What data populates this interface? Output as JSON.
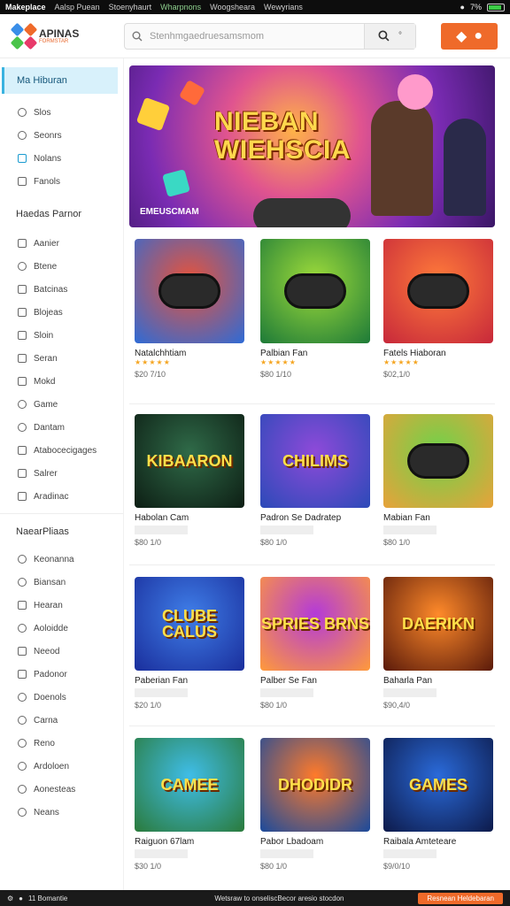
{
  "statusbar": {
    "app": "Makeplace",
    "items": [
      "Aalsp Puean",
      "Stoenyhaurt",
      "Wharpnons",
      "Woogsheara",
      "Wewyrians"
    ],
    "active_index": 2,
    "battery": "7%"
  },
  "header": {
    "logo_text": "APINAS",
    "logo_sub": "FORMSTAR",
    "search_placeholder": "Stenhmgaedruesamsmom",
    "search_extra": "°"
  },
  "sidebar": {
    "active": "Ma Hiburan",
    "top_items": [
      {
        "label": "Slos",
        "icon": "tag-icon"
      },
      {
        "label": "Seonrs",
        "icon": "link-icon"
      },
      {
        "label": "Nolans",
        "icon": "image-icon"
      },
      {
        "label": "Fanols",
        "icon": "page-icon"
      }
    ],
    "section1": "Haedas Parnor",
    "section1_items": [
      {
        "label": "Aanier",
        "icon": "box-icon"
      },
      {
        "label": "Btene",
        "icon": "tag-icon"
      },
      {
        "label": "Batcinas",
        "icon": "check-icon"
      },
      {
        "label": "Blojeas",
        "icon": "grid-icon"
      },
      {
        "label": "Sloin",
        "icon": "grid-icon"
      },
      {
        "label": "Seran",
        "icon": "grid-icon"
      },
      {
        "label": "Mokd",
        "icon": "page-icon"
      },
      {
        "label": "Game",
        "icon": "circle-icon"
      },
      {
        "label": "Dantam",
        "icon": "tag-icon"
      },
      {
        "label": "Atabocecigages",
        "icon": "check-icon"
      },
      {
        "label": "Salrer",
        "icon": "page-icon"
      },
      {
        "label": "Aradinac",
        "icon": "page-icon"
      }
    ],
    "section2": "NaearPliaas",
    "section2_items": [
      {
        "label": "Keonanna",
        "icon": "search-icon"
      },
      {
        "label": "Biansan",
        "icon": "circle-icon"
      },
      {
        "label": "Hearan",
        "icon": "page-icon"
      },
      {
        "label": "Aoloidde",
        "icon": "heart-icon"
      },
      {
        "label": "Neeod",
        "icon": "page-icon"
      },
      {
        "label": "Padonor",
        "icon": "page-icon"
      },
      {
        "label": "Doenols",
        "icon": "circle-icon"
      },
      {
        "label": "Carna",
        "icon": "circle-icon"
      },
      {
        "label": "Reno",
        "icon": "circle-icon"
      },
      {
        "label": "Ardoloen",
        "icon": "circle-icon"
      },
      {
        "label": "Aonesteas",
        "icon": "circle-icon"
      },
      {
        "label": "Neans",
        "icon": "circle-icon"
      }
    ]
  },
  "banner": {
    "title_line1": "NIEBAN",
    "title_line2": "WIEHSCIA",
    "subtitle": "EMEUSCMAM"
  },
  "cards": [
    {
      "name": "Natalchhtiam",
      "stars": "★★★★★",
      "price": "$20 7/10",
      "thumb_title": "",
      "c1": "#e8533a",
      "c2": "#2e6bd6"
    },
    {
      "name": "Palbian Fan",
      "stars": "★★★★★",
      "price": "$80 1/10",
      "thumb_title": "",
      "c1": "#9fdc3a",
      "c2": "#1d7a38"
    },
    {
      "name": "Fatels Hiaboran",
      "stars": "★★★★★",
      "price": "$02,1/0",
      "thumb_title": "",
      "c1": "#ff7b3a",
      "c2": "#c7283a"
    },
    {
      "name": "Habolan Cam",
      "stars": "",
      "price": "$80 1/0",
      "thumb_title": "KIBAARON",
      "c1": "#2f6a48",
      "c2": "#0d1e14"
    },
    {
      "name": "Padron Se Dadratep",
      "stars": "",
      "price": "$80 1/0",
      "thumb_title": "CHILIMS",
      "c1": "#8e4ad9",
      "c2": "#2b4ab8"
    },
    {
      "name": "Mabian Fan",
      "stars": "",
      "price": "$80 1/0",
      "thumb_title": "",
      "c1": "#6fd24a",
      "c2": "#e8a23a"
    },
    {
      "name": "Paberian Fan",
      "stars": "",
      "price": "$20 1/0",
      "thumb_title": "CLUBE CALUS",
      "c1": "#3f7ee8",
      "c2": "#1a2e9c"
    },
    {
      "name": "Palber Se Fan",
      "stars": "",
      "price": "$80 1/0",
      "thumb_title": "SPRIES BRNS",
      "c1": "#b33ad9",
      "c2": "#ff9a3a"
    },
    {
      "name": "Baharla Pan",
      "stars": "",
      "price": "$90,4/0",
      "thumb_title": "DAERIKN",
      "c1": "#ff8a2a",
      "c2": "#5a1a0a"
    },
    {
      "name": "Raiguon 67lam",
      "stars": "",
      "price": "$30 1/0",
      "thumb_title": "CAMEE",
      "c1": "#3fbde8",
      "c2": "#2a7a3a"
    },
    {
      "name": "Pabor Lbadoam",
      "stars": "",
      "price": "$80 1/0",
      "thumb_title": "DHODIDR",
      "c1": "#ff7a2a",
      "c2": "#1a4a9c"
    },
    {
      "name": "Raibala Amteteare",
      "stars": "",
      "price": "$9/0/10",
      "thumb_title": "GAMES",
      "c1": "#2a6ad9",
      "c2": "#0d1a4a"
    }
  ],
  "footer": {
    "left": "11 Bomantie",
    "center": "Wetsraw to onseliscBecor aresio stocdon",
    "button": "Resnean Heldebaran"
  }
}
